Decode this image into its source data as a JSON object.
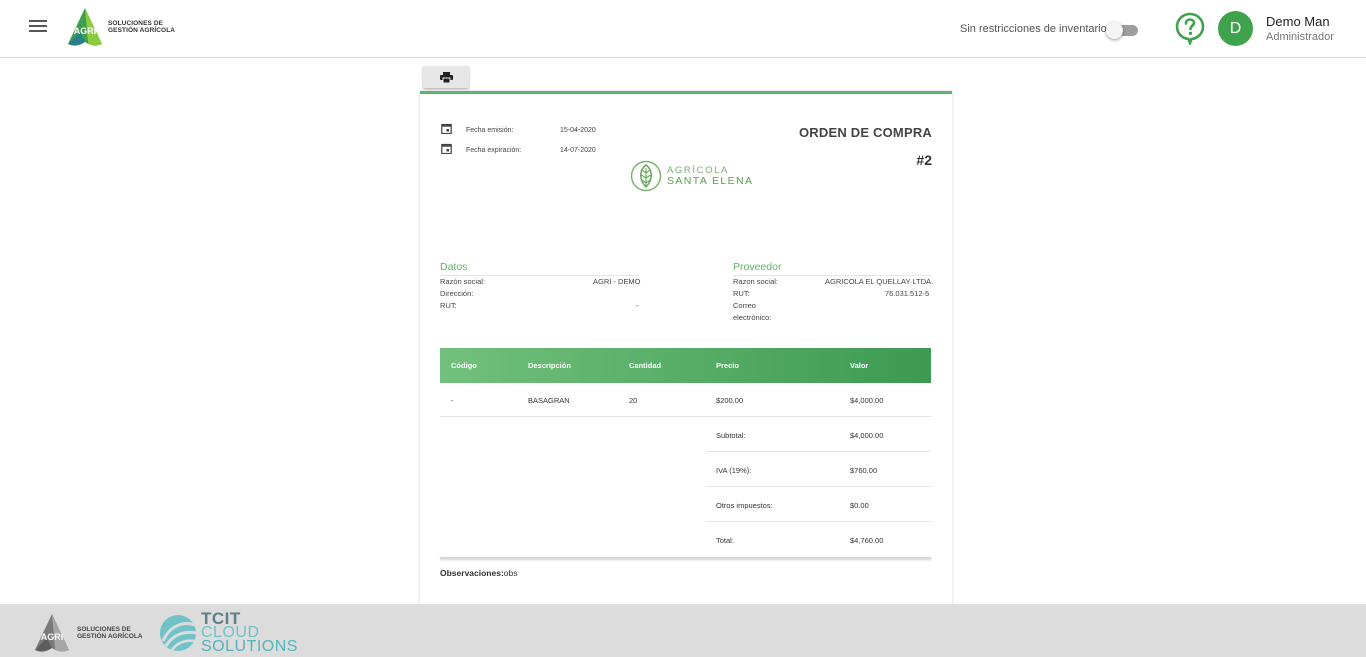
{
  "header": {
    "brand_line1": "SOLUCIONES DE",
    "brand_line2": "GESTIÓN AGRÍCOLA",
    "brand_mark_text": "AGRI",
    "inventory_label": "Sin restricciones de inventario",
    "inventory_toggle_on": false,
    "user_initial": "D",
    "user_name": "Demo Man",
    "user_role": "Administrador",
    "icons": [
      "menu-icon",
      "help-icon",
      "printer-icon",
      "calendar-icon"
    ],
    "colors": {
      "accent": "#5bb56a",
      "avatar": "#3fa34d"
    }
  },
  "document": {
    "fecha_emision_label": "Fecha emisión:",
    "fecha_emision": "15-04-2020",
    "fecha_expiracion_label": "Fecha expiración:",
    "fecha_expiracion": "14-07-2020",
    "title": "ORDEN DE COMPRA",
    "number": "#2",
    "logo_line1": "AGRÍCOLA",
    "logo_line2": "SANTA ELENA",
    "datos": {
      "heading": "Datos",
      "razon_social_label": "Razón social:",
      "razon_social": "AGRI - DEMO",
      "direccion_label": "Dirección:",
      "direccion": "",
      "rut_label": "RUT:",
      "rut": "-"
    },
    "proveedor": {
      "heading": "Proveedor",
      "razon_social_label": "Razon social:",
      "razon_social": "AGRICOLA EL QUELLAY LTDA.",
      "rut_label": "RUT:",
      "rut": "76.031.512-5",
      "correo_label_1": "Correo",
      "correo_label_2": "electrónico:",
      "correo": ""
    },
    "table": {
      "headers": [
        "Código",
        "Descripción",
        "Cantidad",
        "Precio",
        "Valor"
      ],
      "rows": [
        [
          "-",
          "BASAGRAN",
          "20",
          "$200.00",
          "$4,000.00"
        ]
      ],
      "totals": [
        {
          "label": "Subtotal:",
          "value": "$4,000.00"
        },
        {
          "label": "IVA (19%):",
          "value": "$760.00"
        },
        {
          "label": "Otros impuestos:",
          "value": "$0.00"
        },
        {
          "label": "Total:",
          "value": "$4,760.00"
        }
      ]
    },
    "observaciones_label": "Observaciones:",
    "observaciones": "obs"
  },
  "footer": {
    "agri_line1": "SOLUCIONES DE",
    "agri_line2": "GESTIÓN AGRÍCOLA",
    "agri_mark_text": "AGRI",
    "tcit_line1": "TCIT",
    "tcit_line2": "CLOUD",
    "tcit_line3": "SOLUTIONS"
  }
}
